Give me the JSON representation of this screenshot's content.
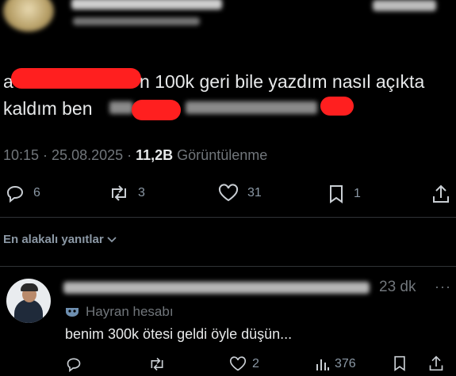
{
  "post": {
    "text_line1_prefix": "a",
    "text_line1_suffix": "n 100k geri bile yazdım nasıl açıkta",
    "text_line2_prefix": "kaldım ben",
    "timestamp": "10:15 · 25.08.2025 · ",
    "views_count": "11,2B",
    "views_label": " Görüntülenme",
    "actions": {
      "replies": "6",
      "reposts": "3",
      "likes": "31",
      "bookmarks": "1"
    }
  },
  "replies_filter": {
    "label": "En alakalı yanıtlar"
  },
  "reply": {
    "time": "23 dk",
    "badge_label": "Hayran hesabı",
    "text": "benim 300k ötesi geldi öyle düşün...",
    "actions": {
      "likes": "2",
      "views": "376"
    }
  },
  "colors": {
    "background": "#000000",
    "text": "#e7e9ea",
    "muted": "#71767b",
    "redaction": "#ff1f1f"
  }
}
